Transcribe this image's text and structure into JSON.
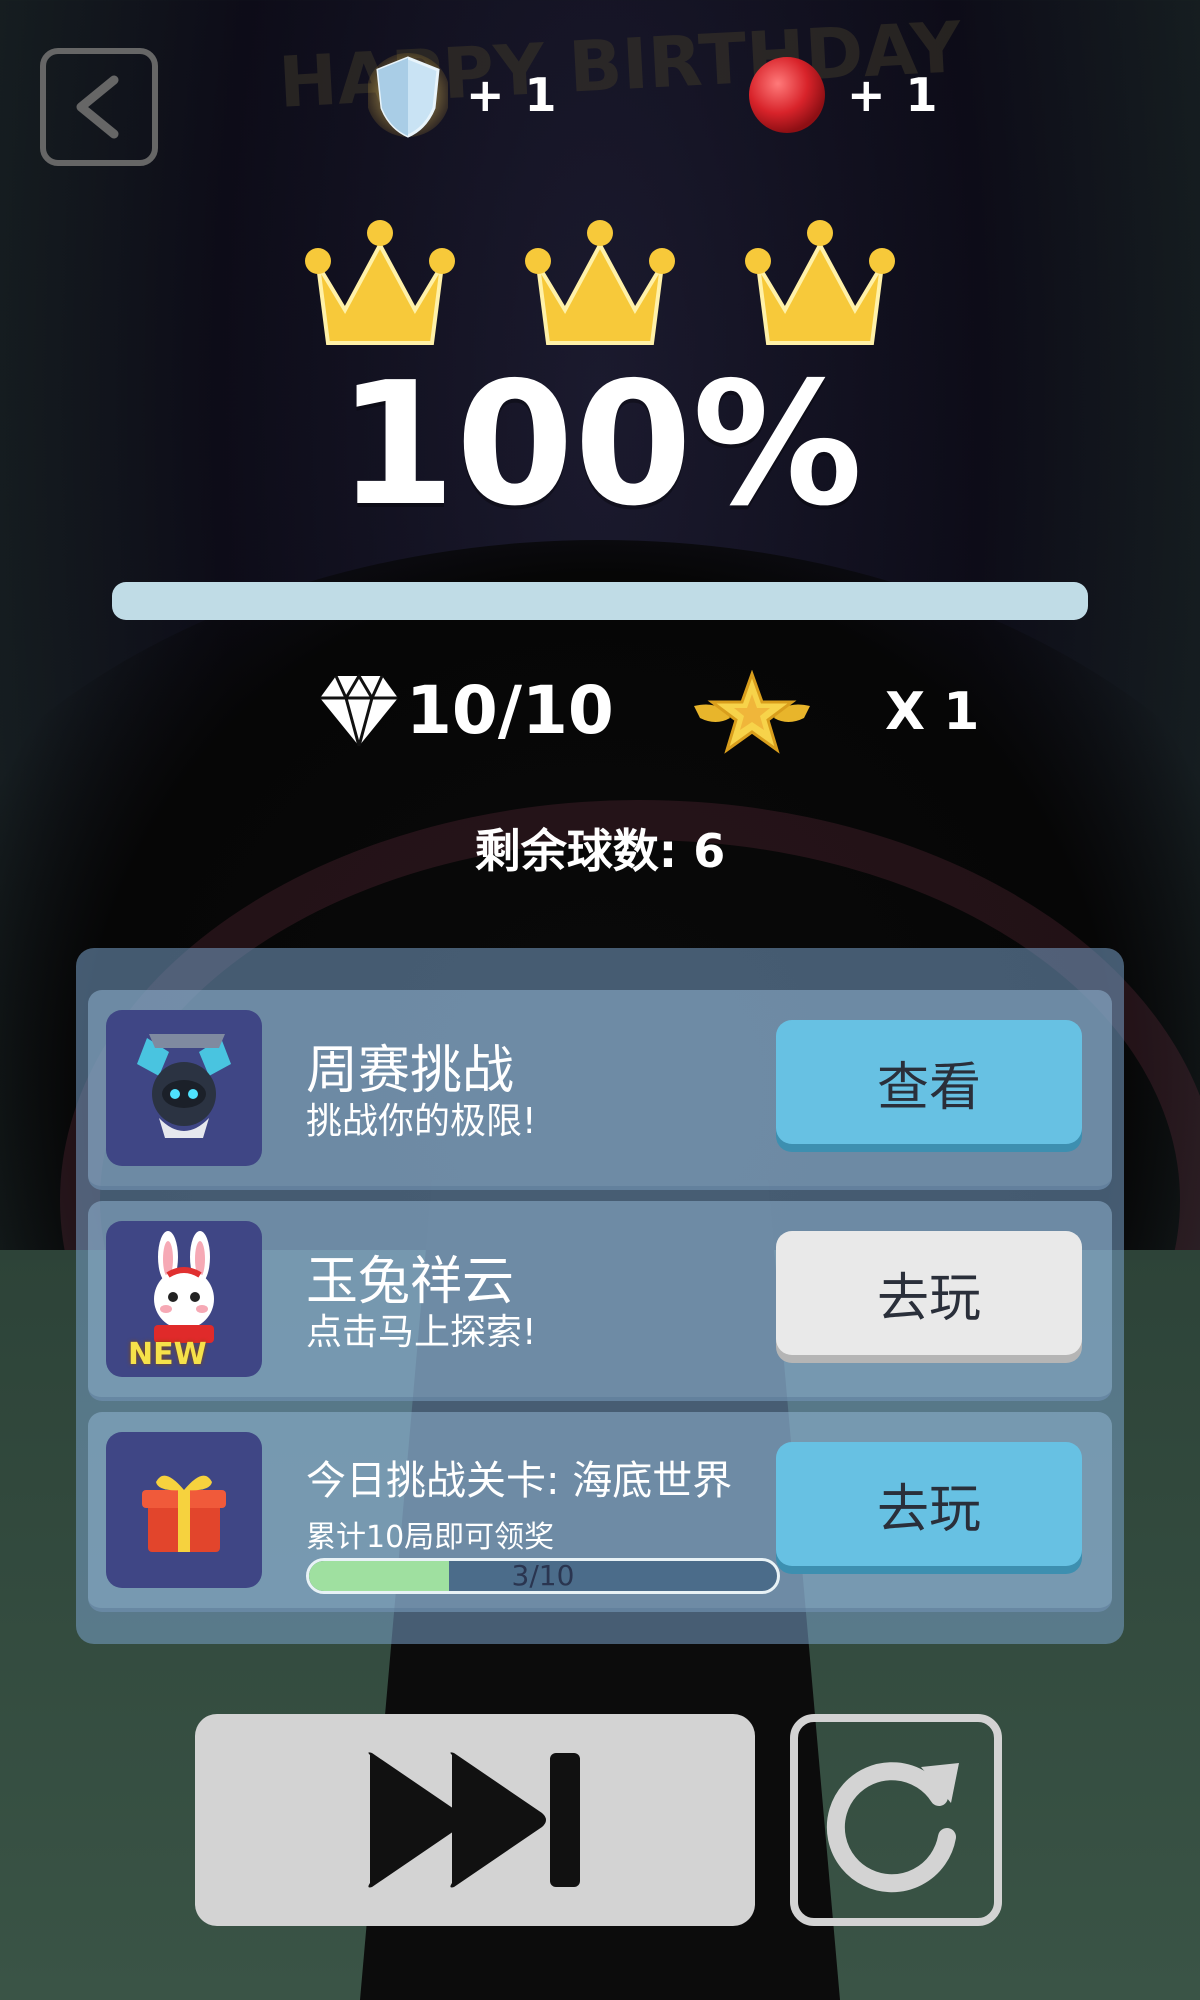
{
  "background": {
    "title": "HAPPY BIRTHDAY"
  },
  "header": {
    "back_icon": "chevron-left-icon",
    "rewards": [
      {
        "icon": "shield-icon",
        "text": "+ 1"
      },
      {
        "icon": "red-ball-icon",
        "text": "+ 1"
      }
    ]
  },
  "result": {
    "crowns_earned": 3,
    "crowns_total": 3,
    "percent_text": "100%",
    "progress_fraction": 1.0
  },
  "stats": {
    "gems": "10/10",
    "star_multiplier": "X 1",
    "balls_remaining": "剩余球数: 6"
  },
  "cards": [
    {
      "title": "周赛挑战",
      "subtitle": "挑战你的极限!",
      "button": "查看",
      "button_style": "blue",
      "icon": "robot-icon"
    },
    {
      "title": "玉兔祥云",
      "subtitle": "点击马上探索!",
      "button": "去玩",
      "button_style": "white",
      "icon": "rabbit-icon",
      "badge": "NEW"
    },
    {
      "title": "今日挑战关卡:  海底世界",
      "subtitle": "累计10局即可领奖",
      "button": "去玩",
      "button_style": "blue",
      "icon": "gift-icon",
      "progress_text": "3/10",
      "progress_fraction": 0.3
    }
  ],
  "controls": {
    "skip_icon": "fast-forward-icon",
    "restart_icon": "restart-icon"
  },
  "colors": {
    "button_blue": "#67c1e3",
    "button_white": "#e9e9e9",
    "crown_gold": "#f7c93a",
    "progress_bar": "#c0dce6",
    "card_thumb": "#3f4685"
  }
}
